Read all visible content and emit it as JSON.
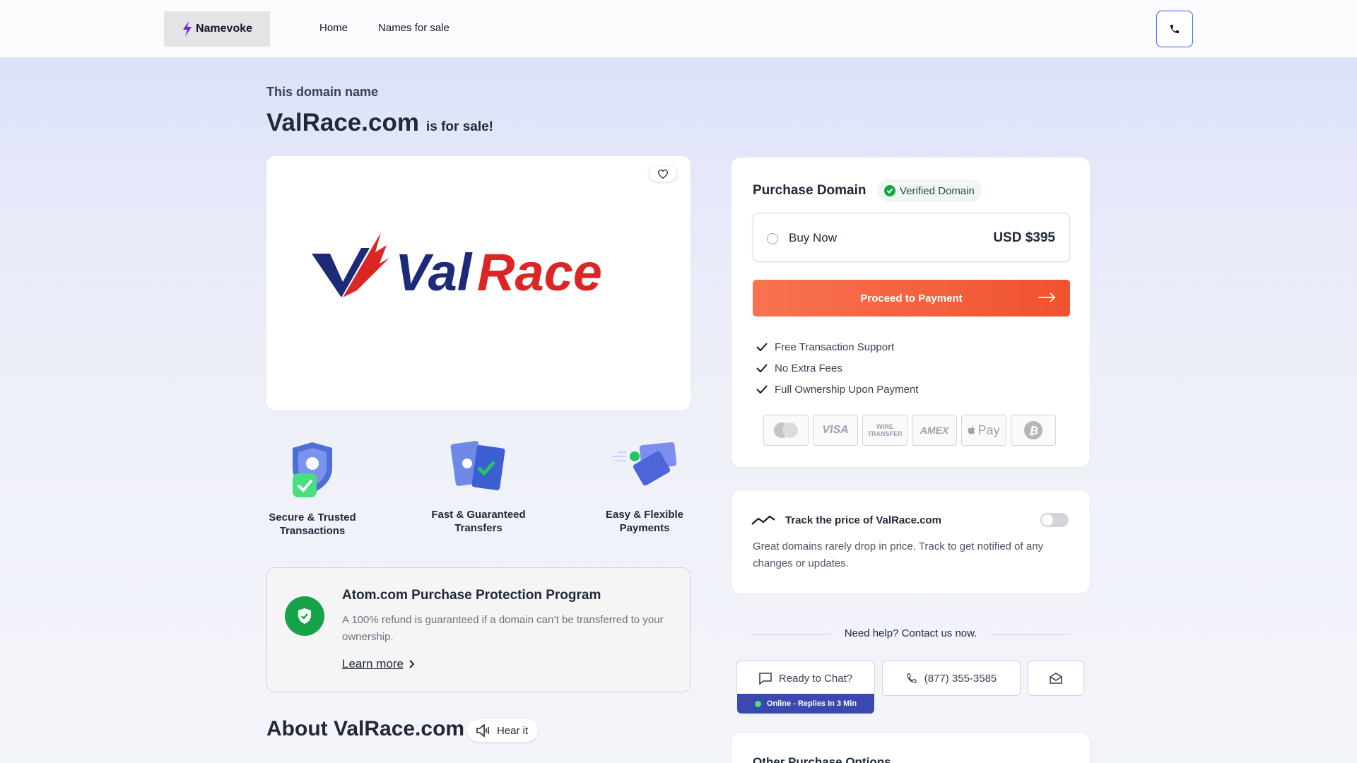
{
  "header": {
    "brand": "Namevoke",
    "nav": [
      "Home",
      "Names for sale"
    ]
  },
  "hero": {
    "eyebrow": "This domain name",
    "domain": "ValRace.com",
    "suffix": "is for sale!"
  },
  "logo": {
    "text_part1": "Val",
    "text_part2": "Race"
  },
  "features": [
    {
      "label_line1": "Secure & Trusted",
      "label_line2": "Transactions"
    },
    {
      "label_line1": "Fast & Guaranteed",
      "label_line2": "Transfers"
    },
    {
      "label_line1": "Easy & Flexible",
      "label_line2": "Payments"
    }
  ],
  "protection": {
    "title": "Atom.com Purchase Protection Program",
    "text": "A 100% refund is guaranteed if a domain can’t be transferred to your ownership.",
    "link": "Learn more"
  },
  "about": {
    "title": "About ValRace.com",
    "hear": "Hear it"
  },
  "purchase": {
    "title": "Purchase Domain",
    "verified": "Verified Domain",
    "option_label": "Buy Now",
    "price": "USD $395",
    "cta": "Proceed to Payment",
    "benefits": [
      "Free Transaction Support",
      "No Extra Fees",
      "Full Ownership Upon Payment"
    ],
    "payment_methods": [
      "mastercard-icon",
      "VISA",
      "WIRE TRANSFER",
      "AMEX",
      "Pay",
      "bitcoin-icon"
    ]
  },
  "track": {
    "title": "Track the price of ValRace.com",
    "text": "Great domains rarely drop in price. Track to get notified of any changes or updates."
  },
  "help": {
    "title": "Need help? Contact us now.",
    "chat": "Ready to Chat?",
    "phone": "(877) 355-3585",
    "online": "Online - Replies In 3 Min"
  },
  "other": {
    "title": "Other Purchase Options"
  },
  "colors": {
    "accent": "#f0522f",
    "brand_blue": "#1e3a8a",
    "brand_red": "#dc2626",
    "verified_green": "#16a34a"
  }
}
